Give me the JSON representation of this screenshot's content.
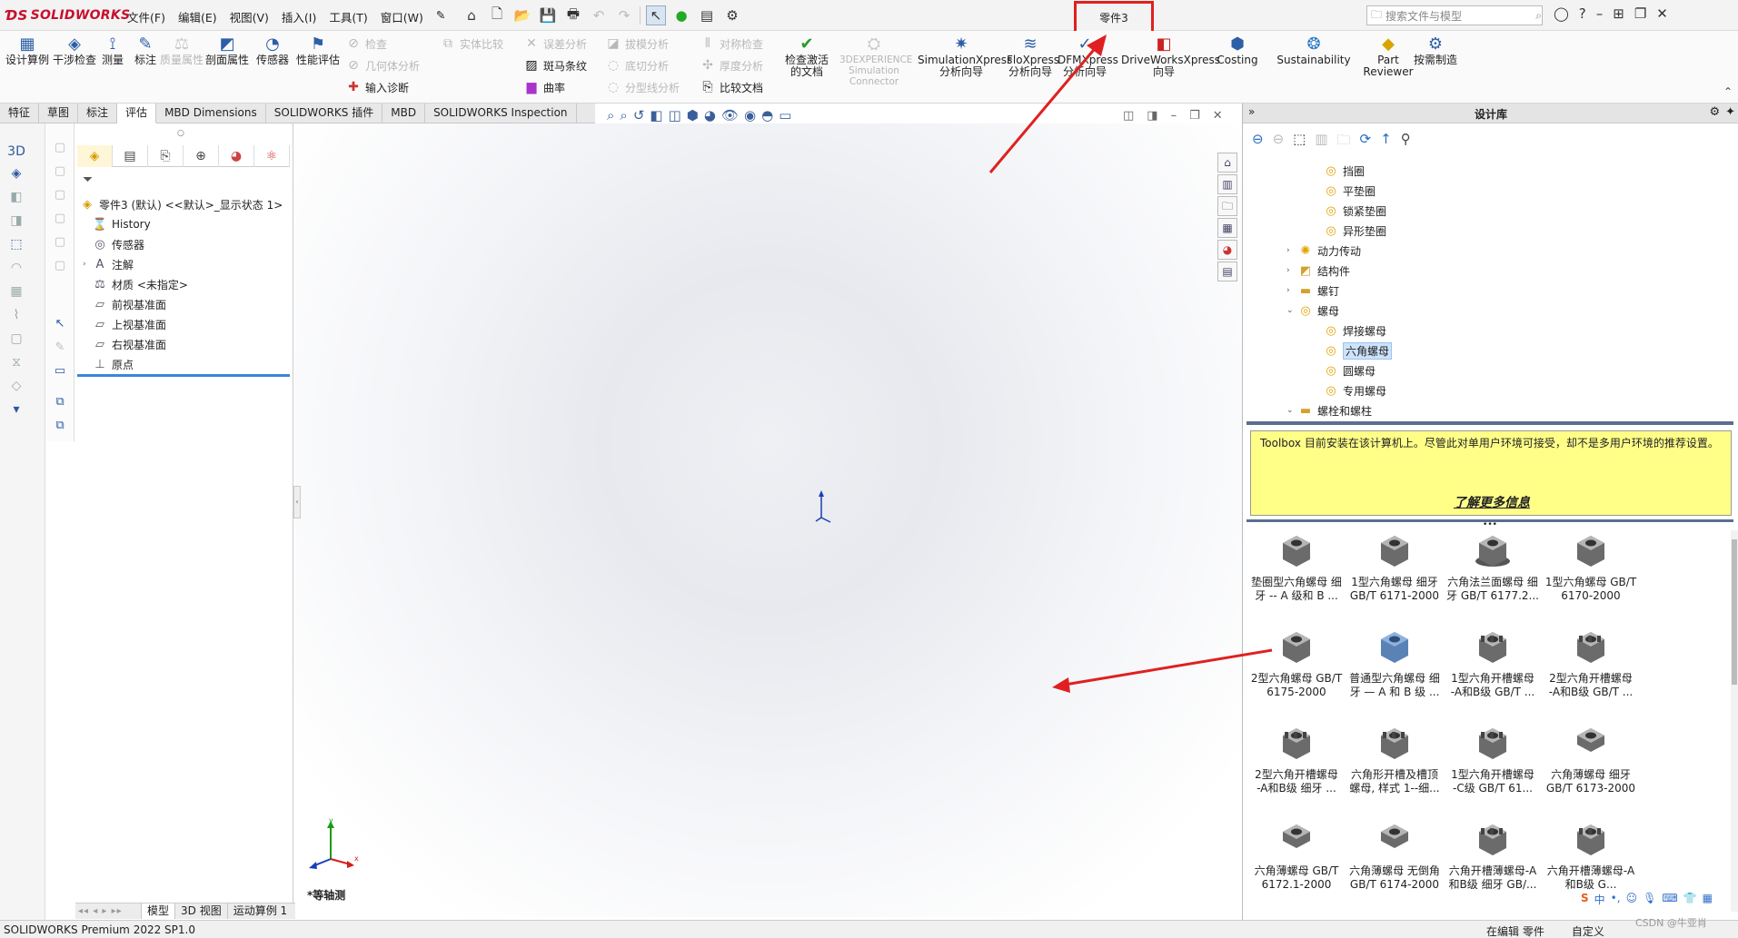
{
  "app": {
    "logo_text": "SOLIDWORKS",
    "doc_title": "零件3"
  },
  "menus": [
    "文件(F)",
    "编辑(E)",
    "视图(V)",
    "插入(I)",
    "工具(T)",
    "窗口(W)"
  ],
  "search": {
    "placeholder": "搜索文件与模型"
  },
  "ribbon": {
    "design_study": "设计算例",
    "interference": "干涉检查",
    "measure": "测量",
    "markup": "标注",
    "mass_props": "质量属性",
    "section_props": "剖面属性",
    "sensor": "传感器",
    "perf_eval": "性能评估",
    "check": "检查",
    "geom_analysis": "几何体分析",
    "import_diag": "输入诊断",
    "body_compare": "实体比较",
    "deviation": "误差分析",
    "zebra": "斑马条纹",
    "curvature": "曲率",
    "draft": "拔模分析",
    "undercut": "底切分析",
    "parting": "分型线分析",
    "symmetry": "对称检查",
    "thickness": "厚度分析",
    "compare_docs": "比较文档",
    "check_active": "检查激活的文档",
    "exp_sim": "3DEXPERIENCE Simulation Connector",
    "simxpress": "SimulationXpress 分析向导",
    "floxpress": "FloXpress 分析向导",
    "dfmxpress": "DFMXpress 分析向导",
    "driveworks": "DriveWorksXpress 向导",
    "costing": "Costing",
    "sustainability": "Sustainability",
    "part_reviewer": "Part Reviewer",
    "on_demand": "按需制造"
  },
  "cmd_tabs": [
    {
      "label": "特征",
      "active": false
    },
    {
      "label": "草图",
      "active": false
    },
    {
      "label": "标注",
      "active": false
    },
    {
      "label": "评估",
      "active": true
    },
    {
      "label": "MBD Dimensions",
      "active": false
    },
    {
      "label": "SOLIDWORKS 插件",
      "active": false
    },
    {
      "label": "MBD",
      "active": false
    },
    {
      "label": "SOLIDWORKS Inspection",
      "active": false
    }
  ],
  "feature_tree": {
    "root": "零件3 (默认) <<默认>_显示状态 1>",
    "items": [
      {
        "label": "History",
        "icon": "history-icon",
        "expand": ""
      },
      {
        "label": "传感器",
        "icon": "sensor-icon",
        "expand": ""
      },
      {
        "label": "注解",
        "icon": "annotation-icon",
        "expand": "›"
      },
      {
        "label": "材质 <未指定>",
        "icon": "material-icon",
        "expand": ""
      },
      {
        "label": "前视基准面",
        "icon": "plane-icon",
        "expand": ""
      },
      {
        "label": "上视基准面",
        "icon": "plane-icon",
        "expand": ""
      },
      {
        "label": "右视基准面",
        "icon": "plane-icon",
        "expand": ""
      },
      {
        "label": "原点",
        "icon": "origin-icon",
        "expand": ""
      }
    ]
  },
  "viewport": {
    "view_label": "*等轴测",
    "axis_x": "x",
    "axis_y": "y"
  },
  "bottom_tabs": [
    {
      "label": "模型",
      "active": true
    },
    {
      "label": "3D 视图",
      "active": false
    },
    {
      "label": "运动算例 1",
      "active": false
    }
  ],
  "status": {
    "left": "SOLIDWORKS Premium 2022 SP1.0",
    "editing": "在编辑 零件",
    "custom": "自定义"
  },
  "task_pane": {
    "title": "设计库",
    "tree": [
      {
        "label": "挡圈",
        "level": 2,
        "kind": "ring",
        "expand": "",
        "selected": false
      },
      {
        "label": "平垫圈",
        "level": 2,
        "kind": "ring",
        "expand": "",
        "selected": false
      },
      {
        "label": "锁紧垫圈",
        "level": 2,
        "kind": "ring",
        "expand": "",
        "selected": false
      },
      {
        "label": "异形垫圈",
        "level": 2,
        "kind": "ring",
        "expand": "",
        "selected": false
      },
      {
        "label": "动力传动",
        "level": 1,
        "kind": "gear",
        "expand": "›",
        "selected": false
      },
      {
        "label": "结构件",
        "level": 1,
        "kind": "beam",
        "expand": "›",
        "selected": false
      },
      {
        "label": "螺钉",
        "level": 1,
        "kind": "folder",
        "expand": "›",
        "selected": false
      },
      {
        "label": "螺母",
        "level": 1,
        "kind": "ring",
        "expand": "⌄",
        "selected": false
      },
      {
        "label": "焊接螺母",
        "level": 2,
        "kind": "ring",
        "expand": "",
        "selected": false
      },
      {
        "label": "六角螺母",
        "level": 2,
        "kind": "ring",
        "expand": "",
        "selected": true
      },
      {
        "label": "圆螺母",
        "level": 2,
        "kind": "ring",
        "expand": "",
        "selected": false
      },
      {
        "label": "专用螺母",
        "level": 2,
        "kind": "ring",
        "expand": "",
        "selected": false
      },
      {
        "label": "螺栓和螺柱",
        "level": 1,
        "kind": "folder",
        "expand": "⌄",
        "selected": false
      }
    ],
    "notice": "Toolbox 目前安装在该计算机上。尽管此对单用户环境可接受，却不是多用户环境的推荐设置。",
    "notice_link": "了解更多信息",
    "parts": [
      [
        "垫圈型六角螺母 细",
        "牙 -- A 级和 B ..."
      ],
      [
        "1型六角螺母 细牙",
        "GB/T 6171-2000"
      ],
      [
        "六角法兰面螺母 细",
        "牙 GB/T 6177.2..."
      ],
      [
        "1型六角螺母 GB/T",
        "6170-2000"
      ],
      [
        "2型六角螺母 GB/T",
        "6175-2000"
      ],
      [
        "普通型六角螺母 细",
        "牙 — A 和 B 级 ..."
      ],
      [
        "1型六角开槽螺母",
        "-A和B级 GB/T ..."
      ],
      [
        "2型六角开槽螺母",
        "-A和B级 GB/T ..."
      ],
      [
        "2型六角开槽螺母",
        "-A和B级 细牙 ..."
      ],
      [
        "六角形开槽及槽顶",
        "螺母, 样式 1--细..."
      ],
      [
        "1型六角开槽螺母",
        "-C级 GB/T 61..."
      ],
      [
        "六角薄螺母 细牙",
        "GB/T 6173-2000"
      ],
      [
        "六角薄螺母 GB/T",
        "6172.1-2000"
      ],
      [
        "六角薄螺母 无倒角",
        "GB/T 6174-2000"
      ],
      [
        "六角开槽薄螺母-A",
        "和B级 细牙 GB/..."
      ],
      [
        "六角开槽薄螺母-A",
        "和B级 G..."
      ]
    ],
    "part_kinds": [
      "plain",
      "plain",
      "flange",
      "plain",
      "plain",
      "blue",
      "slotted",
      "slotted",
      "slotted",
      "slotted",
      "slotted",
      "thin",
      "thin",
      "thin",
      "slotted",
      "slotted"
    ]
  },
  "tray": {
    "ime": "中"
  },
  "watermark": "CSDN @牛亚肖",
  "colors": {
    "accent": "#2d5fa6",
    "annotation_red": "#e02020",
    "notice_bg": "#ffff88",
    "selection": "#cde3fb"
  }
}
